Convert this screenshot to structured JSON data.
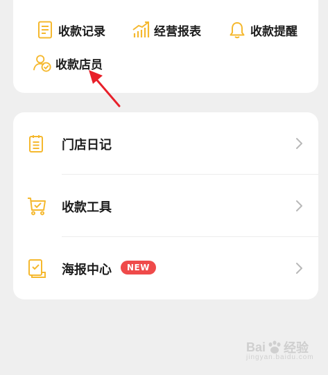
{
  "quick_actions": {
    "items": [
      {
        "label": "收款记录",
        "icon": "document-icon"
      },
      {
        "label": "经营报表",
        "icon": "growth-chart-icon"
      },
      {
        "label": "收款提醒",
        "icon": "bell-icon"
      },
      {
        "label": "收款店员",
        "icon": "staff-check-icon"
      }
    ]
  },
  "menu": {
    "items": [
      {
        "label": "门店日记",
        "icon": "clipboard-icon"
      },
      {
        "label": "收款工具",
        "icon": "cart-icon"
      },
      {
        "label": "海报中心",
        "icon": "poster-icon",
        "badge": "NEW"
      }
    ]
  },
  "watermark": {
    "text_left": "Bai",
    "text_right": "经验",
    "url": "jingyan.baidu.com"
  },
  "colors": {
    "accent": "#f5b82e",
    "badge": "#ef4a4a",
    "arrow": "#e8202a",
    "background": "#efefef"
  }
}
